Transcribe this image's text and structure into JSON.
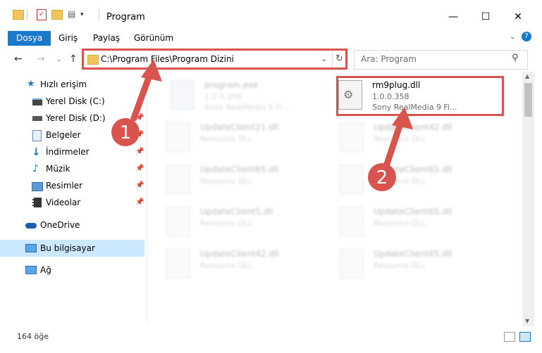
{
  "window": {
    "title": "Program"
  },
  "ribbon": {
    "tabs": [
      "Dosya",
      "Giriş",
      "Paylaş",
      "Görünüm"
    ]
  },
  "address": {
    "path": "C:\\Program Files\\Program Dizini"
  },
  "search": {
    "placeholder": "Ara: Program"
  },
  "sidebar": {
    "items": [
      {
        "label": "Hızlı erişim"
      },
      {
        "label": "Yerel Disk (C:)"
      },
      {
        "label": "Yerel Disk (D:)"
      },
      {
        "label": "Belgeler"
      },
      {
        "label": "İndirmeler"
      },
      {
        "label": "Müzik"
      },
      {
        "label": "Resimler"
      },
      {
        "label": "Videolar"
      },
      {
        "label": "OneDrive"
      },
      {
        "label": "Bu bilgisayar"
      },
      {
        "label": "Ağ"
      }
    ]
  },
  "files": [
    {
      "name": "program.exe",
      "line1": "1.0.0.358",
      "line2": "Sony RealMedia 9 Fi..."
    },
    {
      "name": "rm9plug.dll",
      "line1": "1.0.0.358",
      "line2": "Sony RealMedia 9 Fi..."
    },
    {
      "name": "UpdateClient21.dll",
      "line1": "Resource DLL"
    },
    {
      "name": "UpdateClient42.dll",
      "line1": "Resource DLL"
    },
    {
      "name": "UpdateClient65.dll",
      "line1": "Resource DLL"
    },
    {
      "name": "UpdateClient65.dll",
      "line1": "Resource DLL"
    },
    {
      "name": "UpdateClient5.dll",
      "line1": "Resource DLL"
    },
    {
      "name": "UpdateClient65.dll",
      "line1": "Resource DLL"
    },
    {
      "name": "UpdateClient42.dll",
      "line1": "Resource DLL"
    },
    {
      "name": "UpdateClient65.dll",
      "line1": "Resource DLL"
    }
  ],
  "annotations": {
    "step1": "1",
    "step2": "2"
  },
  "status": {
    "count": "164 öğe"
  },
  "colors": {
    "accent": "#1979ca",
    "highlight": "#d9534f",
    "selected": "#cce8ff"
  }
}
